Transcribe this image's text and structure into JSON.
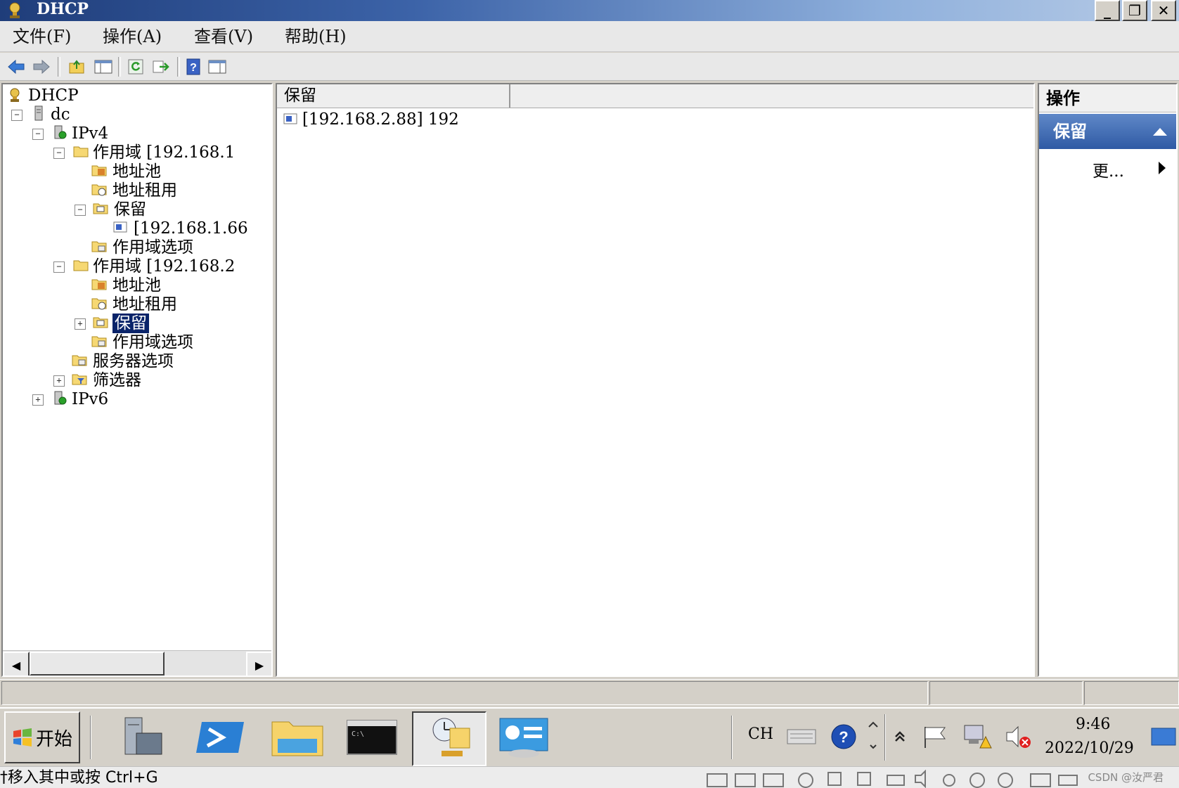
{
  "window": {
    "title": "DHCP"
  },
  "menu": [
    {
      "label": "文件(F)"
    },
    {
      "label": "操作(A)"
    },
    {
      "label": "查看(V)"
    },
    {
      "label": "帮助(H)"
    }
  ],
  "tree": {
    "root": "DHCP",
    "server": "dc",
    "ipv4": "IPv4",
    "scope1": "作用域 [192.168.1",
    "scope1_pool": "地址池",
    "scope1_leases": "地址租用",
    "scope1_reservations": "保留",
    "scope1_res_item": "[192.168.1.66",
    "scope1_options": "作用域选项",
    "scope2": "作用域 [192.168.2",
    "scope2_pool": "地址池",
    "scope2_leases": "地址租用",
    "scope2_reservations": "保留",
    "scope2_options": "作用域选项",
    "server_options": "服务器选项",
    "filters": "筛选器",
    "ipv6": "IPv6"
  },
  "list": {
    "column": "保留",
    "rows": [
      {
        "text": "[192.168.2.88] 192"
      }
    ]
  },
  "actions": {
    "header": "操作",
    "section": "保留",
    "more": "更..."
  },
  "taskbar": {
    "start": "开始",
    "language": "CH",
    "time": "9:46",
    "date": "2022/10/29"
  },
  "status_hint": "†移入其中或按 Ctrl+G",
  "watermark": "CSDN @汝严君"
}
